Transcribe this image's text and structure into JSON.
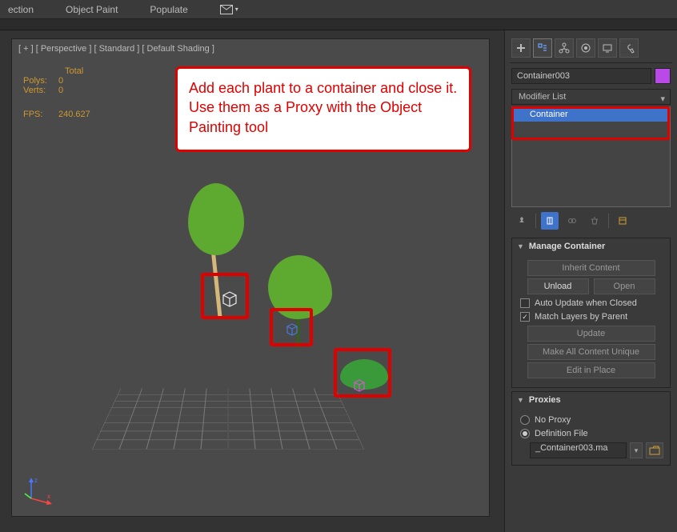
{
  "topbar": {
    "items": [
      "ection",
      "Object Paint",
      "Populate"
    ]
  },
  "viewport": {
    "labels": "[ + ] [ Perspective ] [ Standard ] [ Default Shading ]",
    "stats": {
      "total_hdr": "Total",
      "polys_lbl": "Polys:",
      "polys_val": "0",
      "verts_lbl": "Verts:",
      "verts_val": "0",
      "fps_lbl": "FPS:",
      "fps_val": "240.627"
    },
    "annotation": "Add each plant to a container and close it. Use them as a Proxy with the Object Painting tool",
    "axis_labels": {
      "x": "x",
      "z": "z"
    }
  },
  "panel": {
    "object_name": "Container003",
    "modifier_list_label": "Modifier List",
    "stack_item": "Container",
    "manage_container": {
      "title": "Manage Container",
      "inherit": "Inherit Content",
      "unload": "Unload",
      "open": "Open",
      "auto_update": "Auto Update when Closed",
      "match_layers": "Match Layers by Parent",
      "update": "Update",
      "make_unique": "Make All Content Unique",
      "edit_in_place": "Edit in Place"
    },
    "proxies": {
      "title": "Proxies",
      "no_proxy": "No Proxy",
      "definition_file": "Definition File",
      "file_value": "_Container003.ma"
    }
  }
}
